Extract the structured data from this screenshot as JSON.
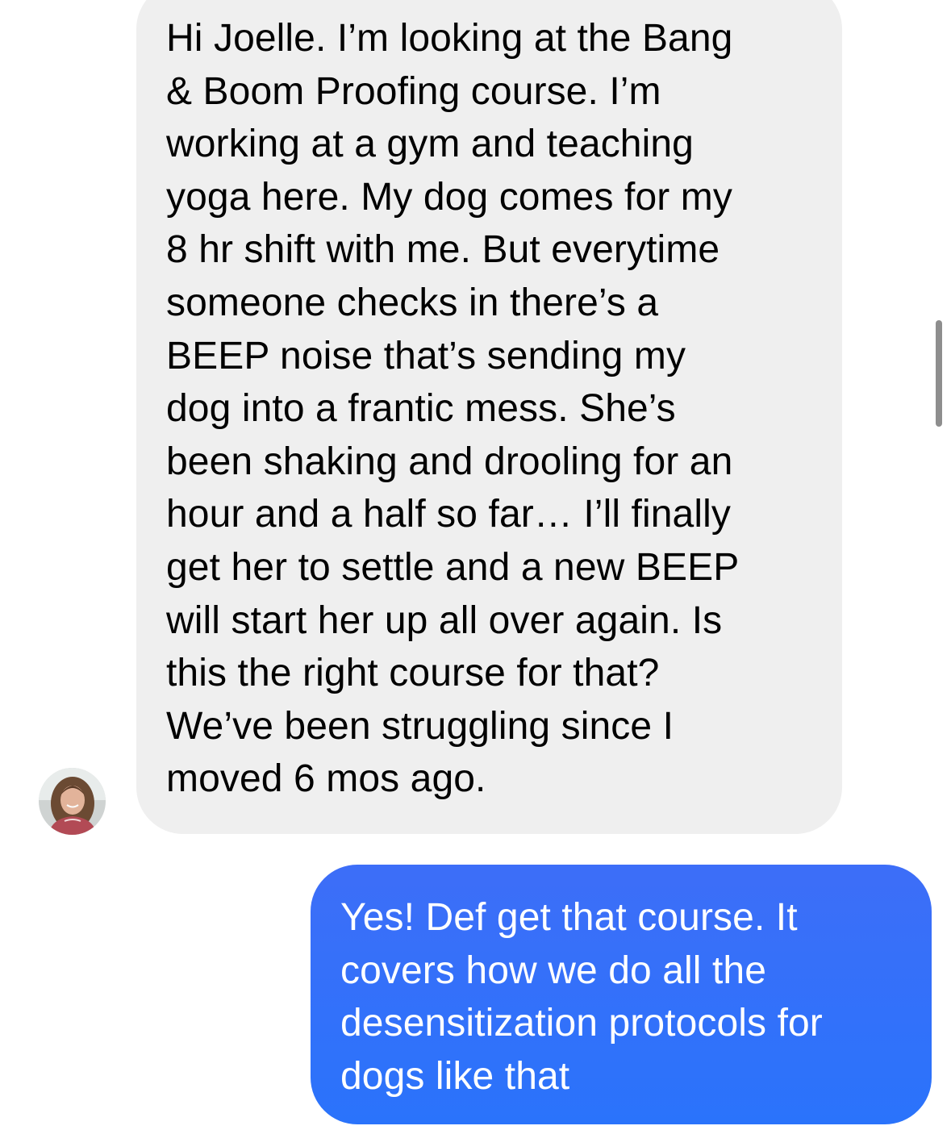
{
  "conversation": {
    "incoming_message": {
      "text": "Hi Joelle. I’m looking at the Bang\n& Boom Proofing course. I’m\nworking at a gym and teaching\nyoga here. My dog comes for my\n8 hr shift with me. But everytime\nsomeone checks in there’s a\nBEEP noise that’s sending my\ndog into a frantic mess. She’s\nbeen shaking and drooling for an\nhour and a half so far… I’ll finally\nget her to settle and a new BEEP\nwill start her up all over again. Is\nthis the right course for that?\nWe’ve been struggling since I\nmoved 6 mos ago.",
      "bubble_color": "#efefef",
      "text_color": "#000000"
    },
    "outgoing_message": {
      "text": "Yes! Def get that course. It\ncovers how we do all the\ndesensitization protocols for\ndogs like that",
      "bubble_color": "#2f71fa",
      "text_color": "#ffffff"
    },
    "sender_avatar": {
      "icon": "profile-photo-avatar"
    }
  }
}
